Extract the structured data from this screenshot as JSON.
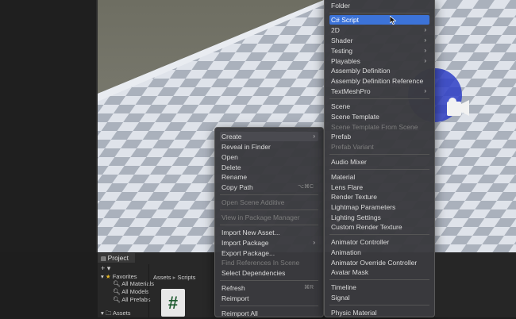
{
  "create_submenu": {
    "items": [
      {
        "label": "Folder",
        "state": "normal",
        "arrow": false
      },
      {
        "label": "C# Script",
        "state": "selected",
        "arrow": false
      },
      {
        "label": "2D",
        "state": "normal",
        "arrow": true
      },
      {
        "label": "Shader",
        "state": "normal",
        "arrow": true
      },
      {
        "label": "Testing",
        "state": "normal",
        "arrow": true
      },
      {
        "label": "Playables",
        "state": "normal",
        "arrow": true
      },
      {
        "label": "Assembly Definition",
        "state": "normal",
        "arrow": false
      },
      {
        "label": "Assembly Definition Reference",
        "state": "normal",
        "arrow": false
      },
      {
        "label": "TextMeshPro",
        "state": "normal",
        "arrow": true
      },
      {
        "label": "Scene",
        "state": "normal",
        "arrow": false
      },
      {
        "label": "Scene Template",
        "state": "normal",
        "arrow": false
      },
      {
        "label": "Scene Template From Scene",
        "state": "disabled",
        "arrow": false
      },
      {
        "label": "Prefab",
        "state": "normal",
        "arrow": false
      },
      {
        "label": "Prefab Variant",
        "state": "disabled",
        "arrow": false
      },
      {
        "label": "Audio Mixer",
        "state": "normal",
        "arrow": false
      },
      {
        "label": "Material",
        "state": "normal",
        "arrow": false
      },
      {
        "label": "Lens Flare",
        "state": "normal",
        "arrow": false
      },
      {
        "label": "Render Texture",
        "state": "normal",
        "arrow": false
      },
      {
        "label": "Lightmap Parameters",
        "state": "normal",
        "arrow": false
      },
      {
        "label": "Lighting Settings",
        "state": "normal",
        "arrow": false
      },
      {
        "label": "Custom Render Texture",
        "state": "normal",
        "arrow": false
      },
      {
        "label": "Animator Controller",
        "state": "normal",
        "arrow": false
      },
      {
        "label": "Animation",
        "state": "normal",
        "arrow": false
      },
      {
        "label": "Animator Override Controller",
        "state": "normal",
        "arrow": false
      },
      {
        "label": "Avatar Mask",
        "state": "normal",
        "arrow": false
      },
      {
        "label": "Timeline",
        "state": "normal",
        "arrow": false
      },
      {
        "label": "Signal",
        "state": "normal",
        "arrow": false
      },
      {
        "label": "Physic Material",
        "state": "normal",
        "arrow": false
      }
    ]
  },
  "context_menu": {
    "items": [
      {
        "label": "Create",
        "state": "selected-parent",
        "arrow": true,
        "shortcut": ""
      },
      {
        "label": "Reveal in Finder",
        "state": "normal",
        "arrow": false,
        "shortcut": ""
      },
      {
        "label": "Open",
        "state": "normal",
        "arrow": false,
        "shortcut": ""
      },
      {
        "label": "Delete",
        "state": "normal",
        "arrow": false,
        "shortcut": ""
      },
      {
        "label": "Rename",
        "state": "normal",
        "arrow": false,
        "shortcut": ""
      },
      {
        "label": "Copy Path",
        "state": "normal",
        "arrow": false,
        "shortcut": "⌥⌘C"
      },
      {
        "label": "Open Scene Additive",
        "state": "disabled",
        "arrow": false,
        "shortcut": ""
      },
      {
        "label": "View in Package Manager",
        "state": "disabled",
        "arrow": false,
        "shortcut": ""
      },
      {
        "label": "Import New Asset...",
        "state": "normal",
        "arrow": false,
        "shortcut": ""
      },
      {
        "label": "Import Package",
        "state": "normal",
        "arrow": true,
        "shortcut": ""
      },
      {
        "label": "Export Package...",
        "state": "normal",
        "arrow": false,
        "shortcut": ""
      },
      {
        "label": "Find References In Scene",
        "state": "disabled",
        "arrow": false,
        "shortcut": ""
      },
      {
        "label": "Select Dependencies",
        "state": "normal",
        "arrow": false,
        "shortcut": ""
      },
      {
        "label": "Refresh",
        "state": "normal",
        "arrow": false,
        "shortcut": "⌘R"
      },
      {
        "label": "Reimport",
        "state": "normal",
        "arrow": false,
        "shortcut": ""
      },
      {
        "label": "Reimport All",
        "state": "normal",
        "arrow": false,
        "shortcut": ""
      }
    ]
  },
  "project_panel": {
    "tab_label": "Project",
    "add_label": "+ ▾",
    "favorites_label": "Favorites",
    "favorites": [
      "All Materials",
      "All Models",
      "All Prefabs"
    ],
    "assets_label": "Assets",
    "breadcrumb": {
      "root": "Assets",
      "sep": "▸",
      "current": "Scripts"
    },
    "script_icon_glyph": "#"
  },
  "colors": {
    "selection": "#3c73d8",
    "menu_bg": "#3a3a3e",
    "disabled_text": "#7d7d7d",
    "favorite_star": "#e7b827"
  }
}
